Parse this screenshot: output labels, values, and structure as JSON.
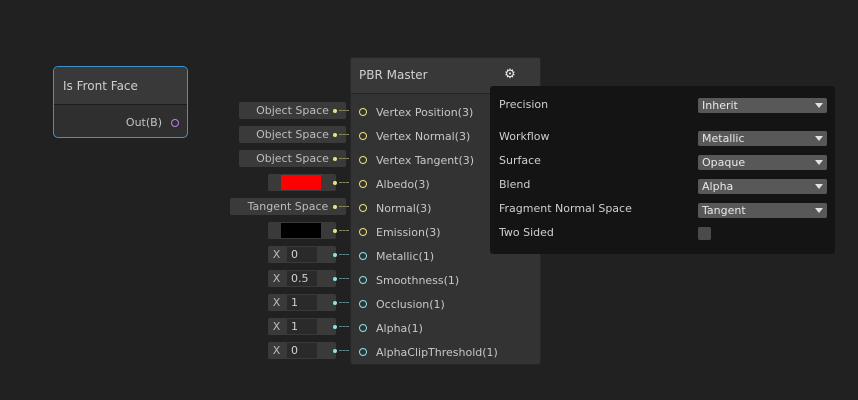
{
  "front_face_node": {
    "title": "Is Front Face",
    "output": "Out(B)"
  },
  "master_node": {
    "title": "PBR Master",
    "slots": [
      {
        "label": "Vertex Position(3)",
        "input": "Object Space"
      },
      {
        "label": "Vertex Normal(3)",
        "input": "Object Space"
      },
      {
        "label": "Vertex Tangent(3)",
        "input": "Object Space"
      },
      {
        "label": "Albedo(3)",
        "color": "#ff0000"
      },
      {
        "label": "Normal(3)",
        "input": "Tangent Space"
      },
      {
        "label": "Emission(3)",
        "color": "#000000"
      },
      {
        "label": "Metallic(1)",
        "x_label": "X",
        "value": "0"
      },
      {
        "label": "Smoothness(1)",
        "x_label": "X",
        "value": "0.5"
      },
      {
        "label": "Occlusion(1)",
        "x_label": "X",
        "value": "1"
      },
      {
        "label": "Alpha(1)",
        "x_label": "X",
        "value": "1"
      },
      {
        "label": "AlphaClipThreshold(1)",
        "x_label": "X",
        "value": "0"
      }
    ]
  },
  "settings": {
    "precision": {
      "label": "Precision",
      "value": "Inherit"
    },
    "workflow": {
      "label": "Workflow",
      "value": "Metallic"
    },
    "surface": {
      "label": "Surface",
      "value": "Opaque"
    },
    "blend": {
      "label": "Blend",
      "value": "Alpha"
    },
    "fragment_normal_space": {
      "label": "Fragment Normal Space",
      "value": "Tangent"
    },
    "two_sided": {
      "label": "Two Sided",
      "checked": false
    }
  },
  "colors": {
    "background": "#212121",
    "selection_outline": "#3f93c9",
    "port_vector3": "#e8e27a",
    "port_vector1": "#84e4e7",
    "port_boolean": "#b488e8"
  },
  "icons": {
    "settings": "gear-icon"
  }
}
